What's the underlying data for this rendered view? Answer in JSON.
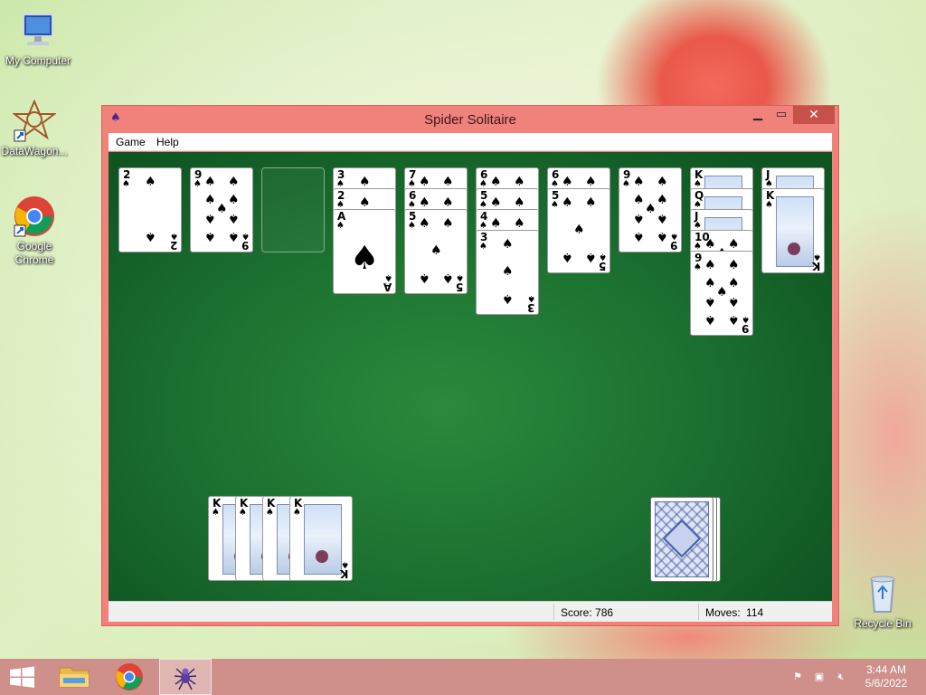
{
  "desktop": {
    "icons": [
      {
        "label": "My Computer",
        "icon": "computer-icon"
      },
      {
        "label": "DataWagon...",
        "icon": "datawagon-icon"
      },
      {
        "label": "Google Chrome",
        "icon": "chrome-icon"
      },
      {
        "label": "Recycle Bin",
        "icon": "recycle-bin-icon"
      }
    ]
  },
  "window": {
    "title": "Spider Solitaire",
    "icon": "spider-solitaire-icon",
    "controls": {
      "minimize": "minimize-icon",
      "maximize": "maximize-icon",
      "close": "close-icon"
    },
    "menu": [
      "Game",
      "Help"
    ]
  },
  "game": {
    "tableau": [
      {
        "facedown": 0,
        "cards": [
          "2"
        ]
      },
      {
        "facedown": 0,
        "cards": [
          "9"
        ]
      },
      {
        "facedown": 0,
        "cards": []
      },
      {
        "facedown": 0,
        "cards": [
          "3",
          "2",
          "A"
        ]
      },
      {
        "facedown": 0,
        "cards": [
          "7",
          "6",
          "5"
        ]
      },
      {
        "facedown": 0,
        "cards": [
          "6",
          "5",
          "4",
          "3"
        ]
      },
      {
        "facedown": 0,
        "cards": [
          "6",
          "5"
        ]
      },
      {
        "facedown": 0,
        "cards": [
          "9"
        ]
      },
      {
        "facedown": 0,
        "cards": [
          "K",
          "Q",
          "J",
          "10",
          "9"
        ]
      },
      {
        "facedown": 0,
        "cards": [
          "J",
          "K"
        ]
      }
    ],
    "suit": "♠",
    "completed_foundations": [
      "K",
      "K",
      "K",
      "K"
    ],
    "stock_piles": 3
  },
  "status": {
    "score_label": "Score:",
    "score": "786",
    "moves_label": "Moves:",
    "moves": "114"
  },
  "taskbar": {
    "items": [
      {
        "name": "start-button",
        "icon": "windows-icon"
      },
      {
        "name": "file-explorer",
        "icon": "folder-icon"
      },
      {
        "name": "chrome",
        "icon": "chrome-icon"
      },
      {
        "name": "spider-solitaire",
        "icon": "spider-icon",
        "active": true
      }
    ],
    "tray_icons": [
      "action-center-flag-icon",
      "network-icon",
      "volume-muted-icon"
    ],
    "time": "3:44 AM",
    "date": "5/6/2022"
  }
}
